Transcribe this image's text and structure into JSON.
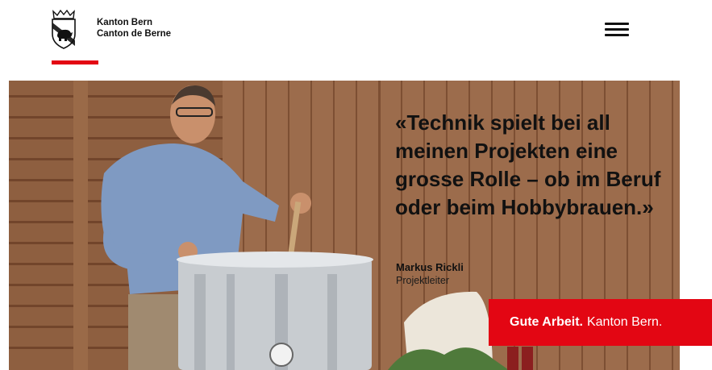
{
  "header": {
    "brand_line1": "Kanton Bern",
    "brand_line2": "Canton de Berne",
    "menu_icon": "hamburger-menu-icon",
    "accent_color": "#e30613"
  },
  "hero": {
    "quote": "«Technik spielt bei all meinen Projekten eine grosse Rolle – ob im Beruf oder beim Hobbybrauen.»",
    "person_name": "Markus Rickli",
    "person_role": "Projektleiter"
  },
  "badge": {
    "bold": "Gute Arbeit.",
    "regular": "Kanton Bern.",
    "color": "#e30613"
  }
}
